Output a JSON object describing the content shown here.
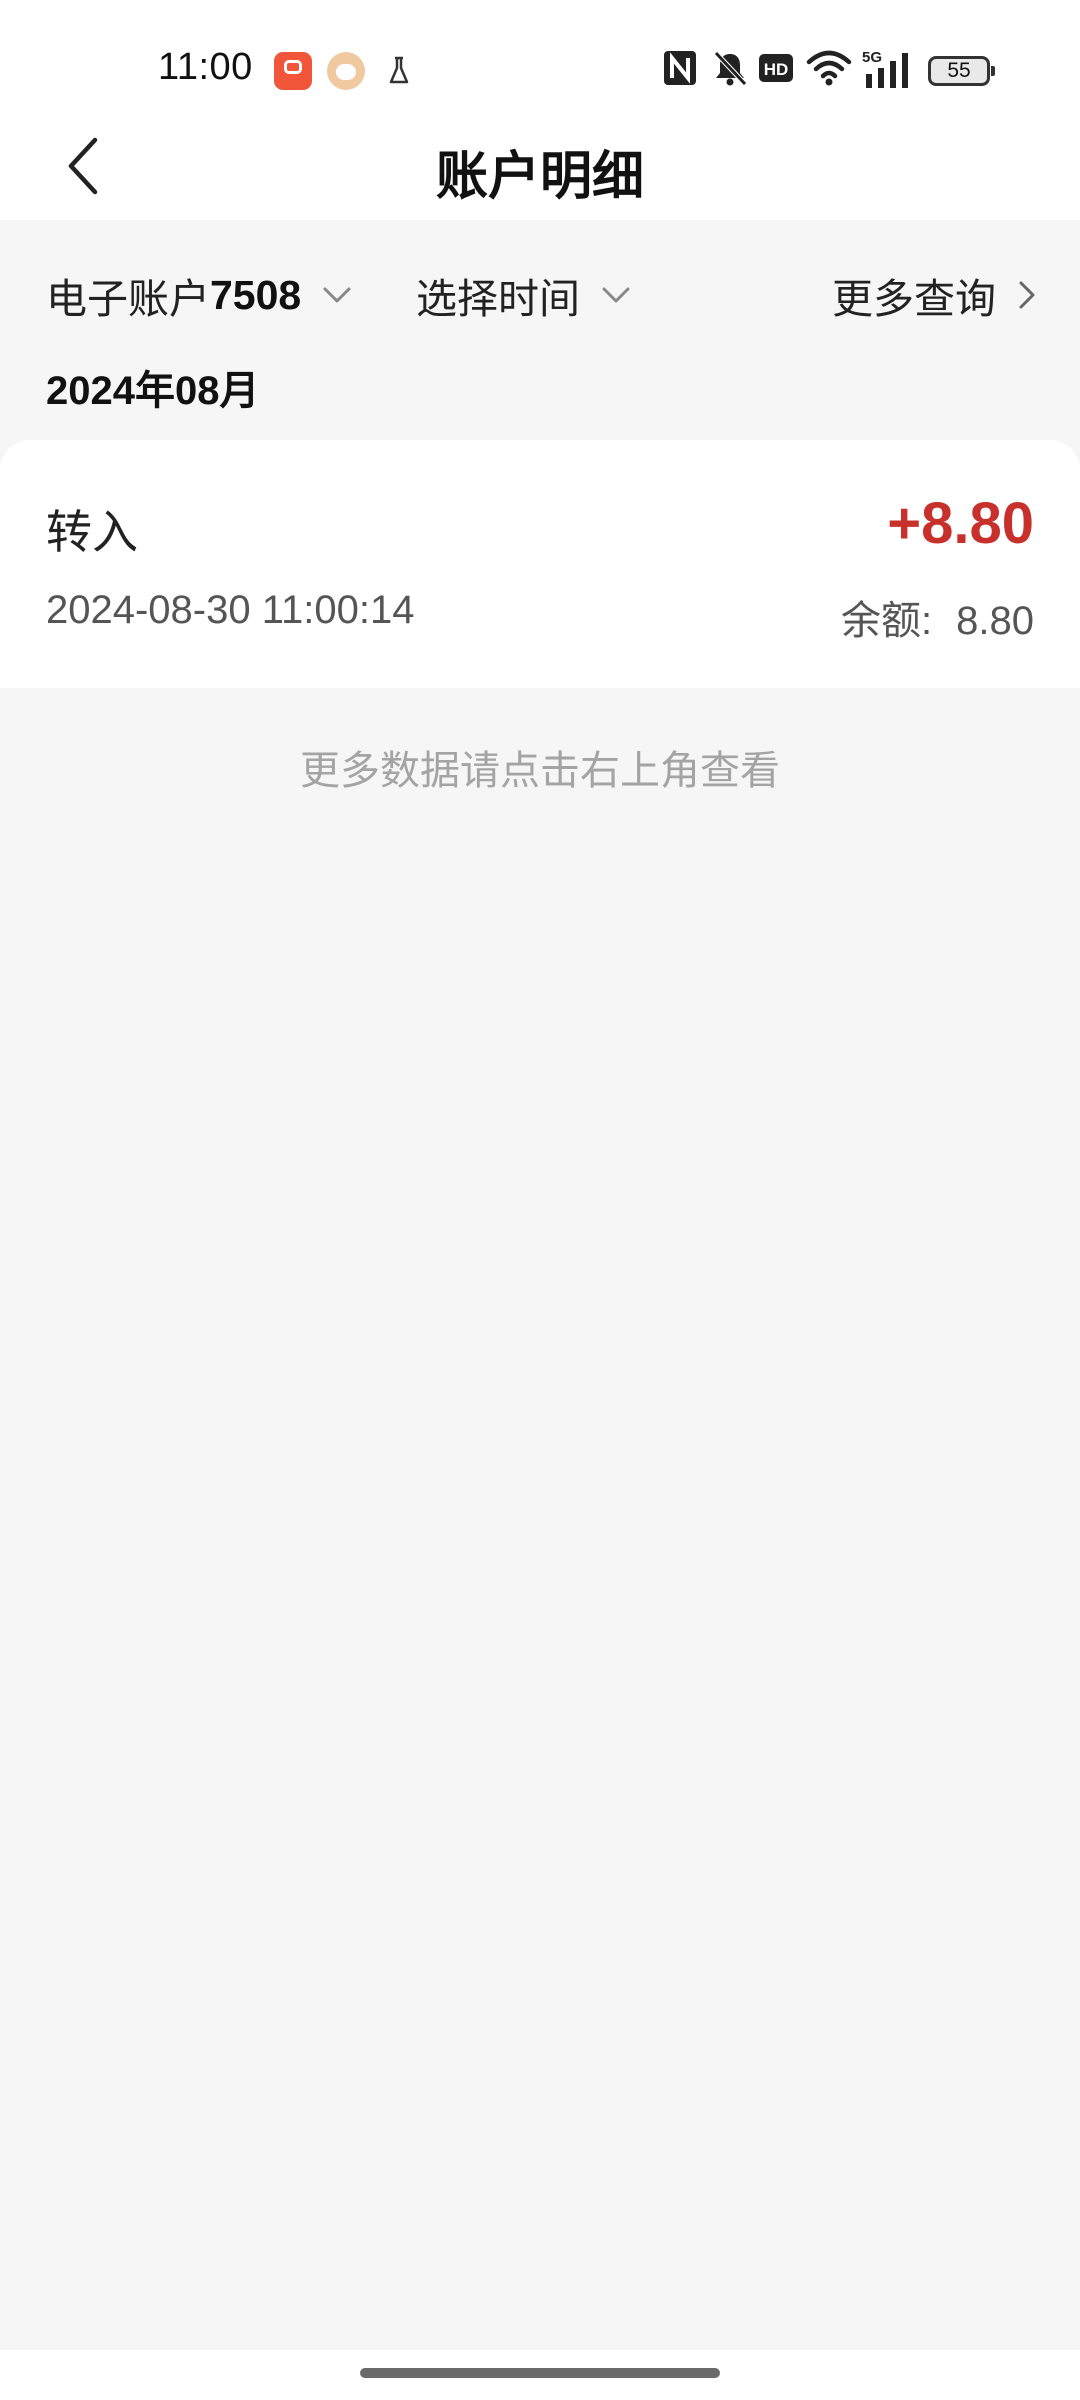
{
  "status_bar": {
    "time": "11:00",
    "battery": "55",
    "icons": [
      "app-icon",
      "app-icon",
      "flask-icon",
      "nfc-icon",
      "mute-icon",
      "hd-icon",
      "wifi-icon",
      "5g-signal-icon",
      "battery-icon"
    ]
  },
  "header": {
    "title": "账户明细",
    "back_icon": "chevron-left-icon"
  },
  "filters": {
    "account_prefix": "电子账户",
    "account_number": "7508",
    "time_label": "选择时间",
    "more_label": "更多查询"
  },
  "month_group": "2024年08月",
  "transactions": [
    {
      "type": "转入",
      "amount": "+8.80",
      "datetime": "2024-08-30 11:00:14",
      "balance_label": "余额:",
      "balance": "8.80"
    }
  ],
  "hint": "更多数据请点击右上角查看",
  "colors": {
    "amount_positive": "#c8302c",
    "background": "#f6f6f6",
    "card": "#ffffff"
  }
}
